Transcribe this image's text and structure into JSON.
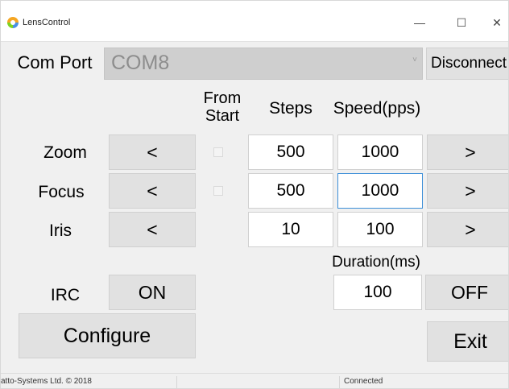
{
  "window": {
    "title": "LensControl",
    "minimize_glyph": "—",
    "maximize_glyph": "☐",
    "close_glyph": "✕"
  },
  "comport": {
    "label": "Com Port",
    "value": "COM8",
    "disconnect_label": "Disconnect"
  },
  "headers": {
    "from_start_line1": "From",
    "from_start_line2": "Start",
    "steps": "Steps",
    "speed": "Speed(pps)",
    "duration": "Duration(ms)"
  },
  "rows": {
    "zoom": {
      "label": "Zoom",
      "left_label": "<",
      "steps": "500",
      "speed": "1000",
      "right_label": ">"
    },
    "focus": {
      "label": "Focus",
      "left_label": "<",
      "steps": "500",
      "speed": "1000",
      "right_label": ">"
    },
    "iris": {
      "label": "Iris",
      "left_label": "<",
      "steps": "10",
      "speed": "100",
      "right_label": ">"
    }
  },
  "irc": {
    "label": "IRC",
    "on_label": "ON",
    "duration": "100",
    "off_label": "OFF"
  },
  "buttons": {
    "configure_label": "Configure",
    "exit_label": "Exit"
  },
  "statusbar": {
    "copyright": "atto-Systems Ltd. © 2018",
    "connection": "Connected"
  }
}
